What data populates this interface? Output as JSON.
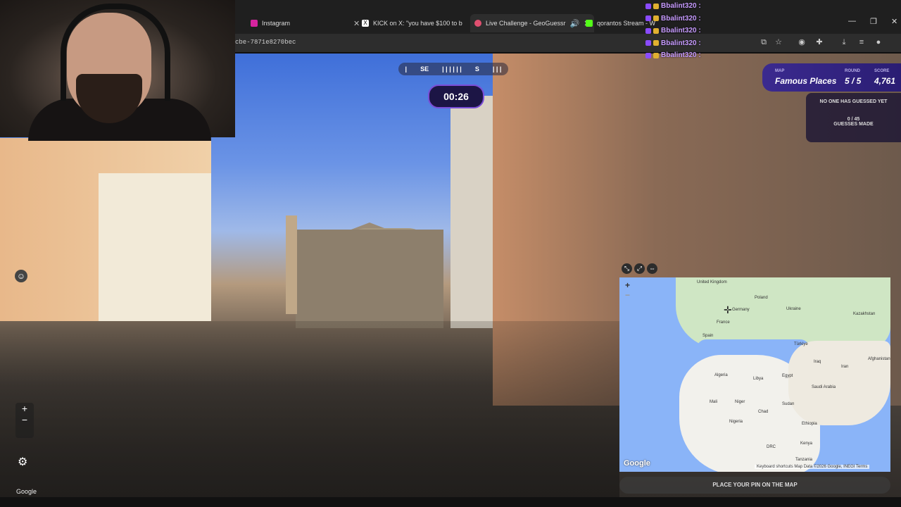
{
  "browser": {
    "tabs": [
      {
        "label": "Instagram",
        "icon": "instagram-icon"
      },
      {
        "label": "KICK on X: \"you have $100 to b",
        "icon": "x-icon"
      },
      {
        "label": "Live Challenge - GeoGuessr",
        "icon": "geoguessr-icon",
        "active": true
      },
      {
        "label": "qorantos Stream - W",
        "icon": "kick-icon"
      }
    ],
    "url": "cbe-7871e8270bec"
  },
  "game": {
    "compass_left": "SE",
    "compass_right": "S",
    "timer": "00:26",
    "map_label": "MAP",
    "map_value": "Famous Places",
    "round_label": "ROUND",
    "round_value": "5 / 5",
    "score_label": "SCORE",
    "score_value": "4,761",
    "no_guess": "NO ONE HAS GUESSED YET",
    "guesses_count": "0 / 45",
    "guesses_label": "GUESSES MADE",
    "place_pin": "PLACE YOUR PIN ON THE MAP"
  },
  "chat": {
    "lines": [
      "Bbalint320 :",
      "Bbalint320 :",
      "Bbalint320 :",
      "Bbalint320 :",
      "Bbalint320 :"
    ]
  },
  "map": {
    "labels": {
      "uk": "United Kingdom",
      "poland": "Poland",
      "ukraine": "Ukraine",
      "kazakhstan": "Kazakhstan",
      "germany": "Germany",
      "france": "France",
      "spain": "Spain",
      "turkiye": "Türkiye",
      "iraq": "Iraq",
      "iran": "Iran",
      "afghanistan": "Afghanistan",
      "algeria": "Algeria",
      "libya": "Libya",
      "egypt": "Egypt",
      "saudi": "Saudi Arabia",
      "mali": "Mali",
      "niger": "Niger",
      "chad": "Chad",
      "sudan": "Sudan",
      "nigeria": "Nigeria",
      "ethiopia": "Ethiopia",
      "kenya": "Kenya",
      "drc": "DRC",
      "tanzania": "Tanzania"
    },
    "logo": "Google",
    "footer": "Keyboard shortcuts   Map Data ©2026 Google, INEGI   Terms"
  },
  "streetview": {
    "watermark": "Google"
  },
  "colors": {
    "accent": "#7a4dd6",
    "score_panel": "#3b2a8f",
    "chat_name": "#c79bff"
  }
}
